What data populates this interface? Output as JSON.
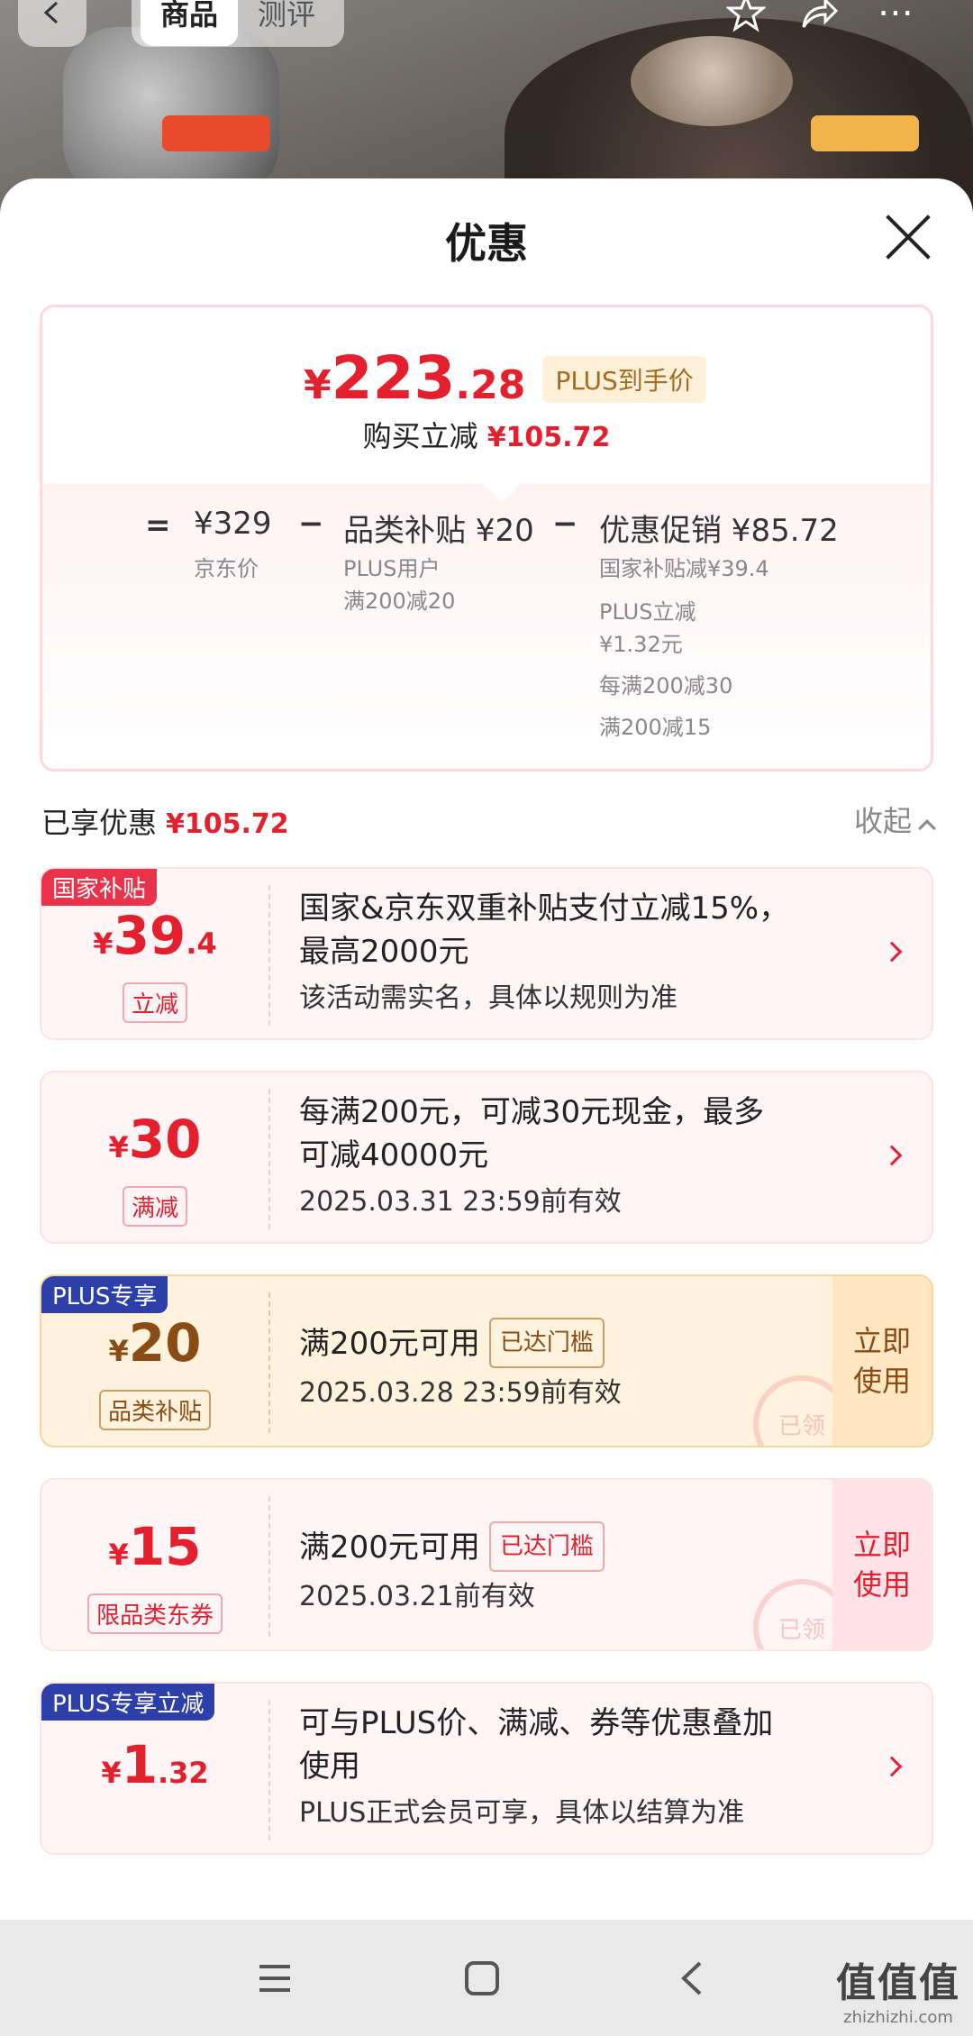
{
  "top": {
    "tabs": [
      "商品",
      "测评"
    ],
    "back_icon": "chevron-left-icon",
    "icons": [
      "star-icon",
      "share-icon",
      "more-icon"
    ]
  },
  "sheet": {
    "title": "优惠",
    "close_icon": "close-icon"
  },
  "summary": {
    "price_yen": "¥",
    "price_int": "223",
    "price_dec": ".28",
    "plus_tag": "PLUS到手价",
    "reduce_label": "购买立减",
    "reduce_value": "¥105.72",
    "eq": "=",
    "minus": "−",
    "jd_price": "¥329",
    "jd_price_label": "京东价",
    "cat_title": "品类补贴 ¥20",
    "cat_sub1": "PLUS用户",
    "cat_sub2": "满200减20",
    "promo_title": "优惠促销 ¥85.72",
    "promo_lines": [
      "国家补贴减¥39.4",
      "PLUS立减",
      "¥1.32元",
      "每满200减30",
      "满200减15"
    ]
  },
  "enjoyed": {
    "label": "已享优惠",
    "value": "¥105.72",
    "collapse": "收起"
  },
  "cards": [
    {
      "tag": "国家补贴",
      "yen": "¥",
      "num": "39",
      "dec": ".4",
      "sub": "立减",
      "line1": "国家&京东双重补贴支付立减15%，",
      "line1b": "最高2000元",
      "line2": "该活动需实名，具体以规则为准"
    },
    {
      "tag": "",
      "yen": "¥",
      "num": "30",
      "dec": "",
      "sub": "满减",
      "line1": "每满200元，可减30元现金，最多",
      "line1b": "可减40000元",
      "line2": "2025.03.31 23:59前有效"
    },
    {
      "tag": "PLUS专享",
      "yen": "¥",
      "num": "20",
      "dec": "",
      "sub": "品类补贴",
      "line1": "满200元可用",
      "threshold": "已达门槛",
      "line2": "2025.03.28 23:59前有效",
      "button": "立即使用",
      "button1": "立即",
      "button2": "使用",
      "stamp": "已领"
    },
    {
      "tag": "",
      "yen": "¥",
      "num": "15",
      "dec": "",
      "sub": "限品类东券",
      "line1": "满200元可用",
      "threshold": "已达门槛",
      "line2": "2025.03.21前有效",
      "button1": "立即",
      "button2": "使用",
      "stamp": "已领"
    },
    {
      "tag": "PLUS专享立减",
      "yen": "¥",
      "num": "1",
      "dec": ".32",
      "sub": "",
      "line1": "可与PLUS价、满减、券等优惠叠加",
      "line1b": "使用",
      "line2": "PLUS正式会员可享，具体以结算为准"
    }
  ],
  "navbar": {
    "icons": [
      "menu-icon",
      "home-icon",
      "back-icon"
    ]
  },
  "watermark": {
    "title": "值值值",
    "url": "zhizhizhi.com"
  }
}
